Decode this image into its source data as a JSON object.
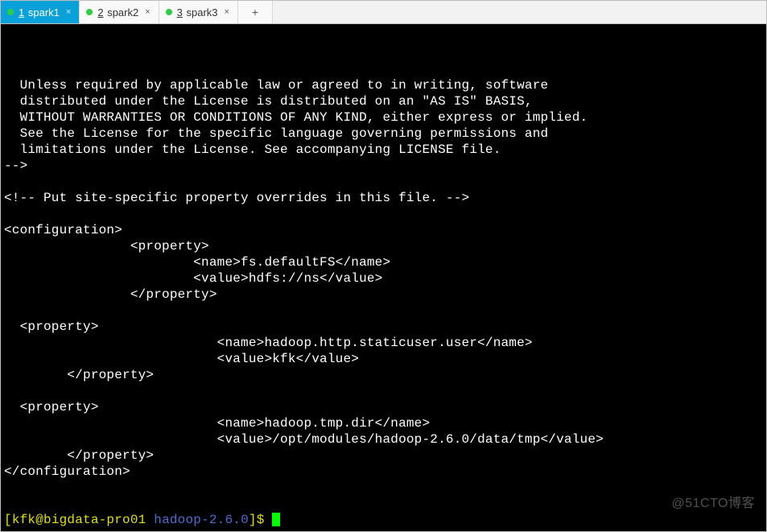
{
  "tabs": [
    {
      "num": "1",
      "label": "spark1",
      "active": true
    },
    {
      "num": "2",
      "label": "spark2",
      "active": false
    },
    {
      "num": "3",
      "label": "spark3",
      "active": false
    }
  ],
  "new_tab_glyph": "+",
  "close_glyph": "×",
  "terminal_lines": [
    "",
    "  Unless required by applicable law or agreed to in writing, software",
    "  distributed under the License is distributed on an \"AS IS\" BASIS,",
    "  WITHOUT WARRANTIES OR CONDITIONS OF ANY KIND, either express or implied.",
    "  See the License for the specific language governing permissions and",
    "  limitations under the License. See accompanying LICENSE file.",
    "-->",
    "",
    "<!-- Put site-specific property overrides in this file. -->",
    "",
    "<configuration>",
    "                <property>",
    "                        <name>fs.defaultFS</name>",
    "                        <value>hdfs://ns</value>",
    "                </property>",
    "",
    "  <property>",
    "                           <name>hadoop.http.staticuser.user</name>",
    "                           <value>kfk</value>",
    "        </property>",
    "",
    "  <property>",
    "                           <name>hadoop.tmp.dir</name>",
    "                           <value>/opt/modules/hadoop-2.6.0/data/tmp</value>",
    "        </property>",
    "</configuration>"
  ],
  "prompt": {
    "user_host": "kfk@bigdata-pro01",
    "path": "hadoop-2.6.0",
    "open_bracket": "[",
    "close_bracket": "]",
    "dollar": "$ "
  },
  "watermark": "@51CTO博客"
}
